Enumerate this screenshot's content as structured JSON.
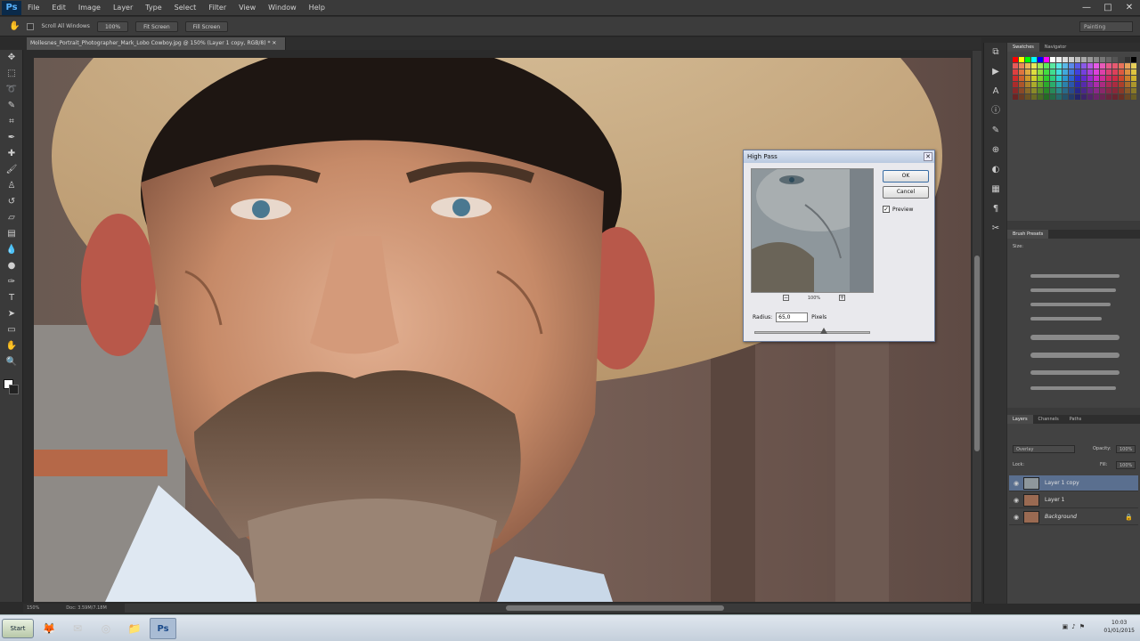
{
  "app": {
    "logo": "Ps",
    "menus": [
      "File",
      "Edit",
      "Image",
      "Layer",
      "Type",
      "Select",
      "Filter",
      "View",
      "Window",
      "Help"
    ],
    "window_controls": [
      "—",
      "□",
      "✕"
    ]
  },
  "options": {
    "scroll_all": "Scroll All Windows",
    "btn1": "100%",
    "btn2": "Fit Screen",
    "btn3": "Fill Screen",
    "workspace": "Painting"
  },
  "document": {
    "tab_title": "Mollesnes_Portrait_Photographer_Mark_Lobo Cowboy.jpg @ 150% (Layer 1 copy, RGB/8) *",
    "zoom": "150%",
    "doc_size": "Doc: 3.59M/7.18M"
  },
  "dialog": {
    "title": "High Pass",
    "ok": "OK",
    "cancel": "Cancel",
    "preview_label": "Preview",
    "preview_checked": "✓",
    "zoom": "100%",
    "radius_label": "Radius:",
    "radius_value": "65,0",
    "radius_unit": "Pixels",
    "slider_fraction": 0.6
  },
  "panels": {
    "swatches_tab": "Swatches",
    "navigator_tab": "Navigator",
    "brush_presets_tab": "Brush Presets",
    "size_label": "Size:",
    "layers_tab": "Layers",
    "channels_tab": "Channels",
    "paths_tab": "Paths",
    "blend_mode": "Overlay",
    "opacity_label": "Opacity:",
    "opacity_value": "100%",
    "lock_label": "Lock:",
    "fill_label": "Fill:",
    "fill_value": "100%",
    "layers": [
      {
        "name": "Layer 1 copy",
        "selected": true
      },
      {
        "name": "Layer 1",
        "selected": false
      },
      {
        "name": "Background",
        "selected": false
      }
    ]
  },
  "taskbar": {
    "start": "Start",
    "time": "10:03",
    "date": "01/01/2015"
  }
}
